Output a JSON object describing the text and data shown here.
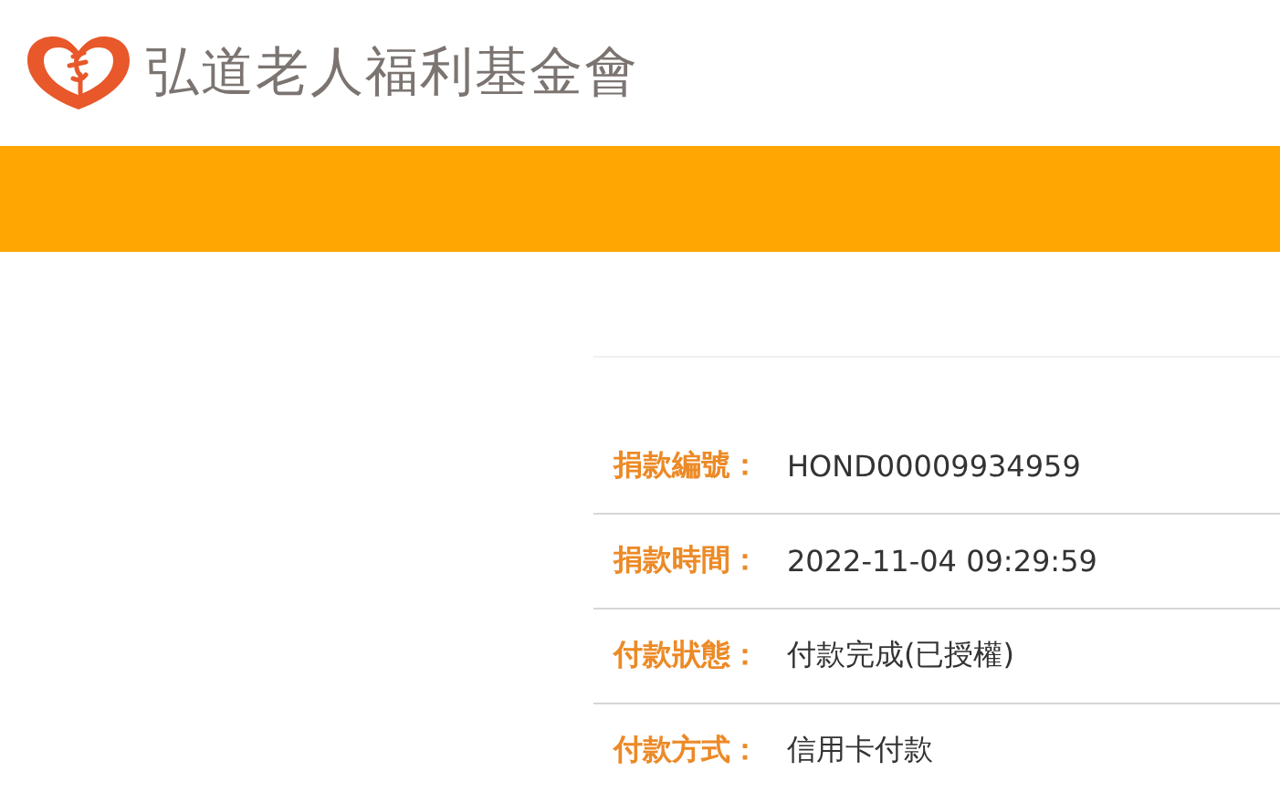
{
  "header": {
    "title": "弘道老人福利基金會"
  },
  "details": [
    {
      "label": "捐款編號：",
      "value": "HOND00009934959"
    },
    {
      "label": "捐款時間：",
      "value": "2022-11-04 09:29:59"
    },
    {
      "label": "付款狀態：",
      "value": "付款完成(已授權)"
    },
    {
      "label": "付款方式：",
      "value": "信用卡付款"
    }
  ]
}
